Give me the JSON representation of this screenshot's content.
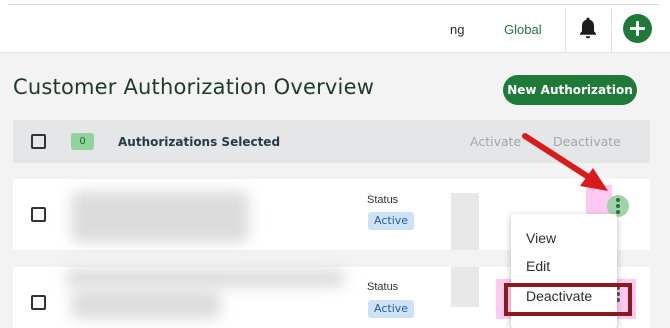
{
  "topbar": {
    "tab_partial": "ng",
    "tab_global": "Global"
  },
  "page": {
    "title": "Customer Authorization Overview",
    "new_button": "New Authorization"
  },
  "table_header": {
    "selected_count": "0",
    "selected_label": "Authorizations Selected",
    "activate": "Activate",
    "deactivate": "Deactivate"
  },
  "rows": [
    {
      "status_label": "Status",
      "status": "Active"
    },
    {
      "status_label": "Status",
      "status": "Active"
    }
  ],
  "menu": {
    "items": [
      "View",
      "Edit",
      "Deactivate"
    ]
  },
  "colors": {
    "brand_green": "#1f7a3a",
    "annotation_red": "#d81b1b",
    "highlight_pink": "#ff3cd8",
    "status_badge_bg": "#cde2f6"
  },
  "icons": {
    "bell": "bell-icon",
    "add": "plus-circle-icon",
    "kebab": "kebab-menu-icon"
  }
}
